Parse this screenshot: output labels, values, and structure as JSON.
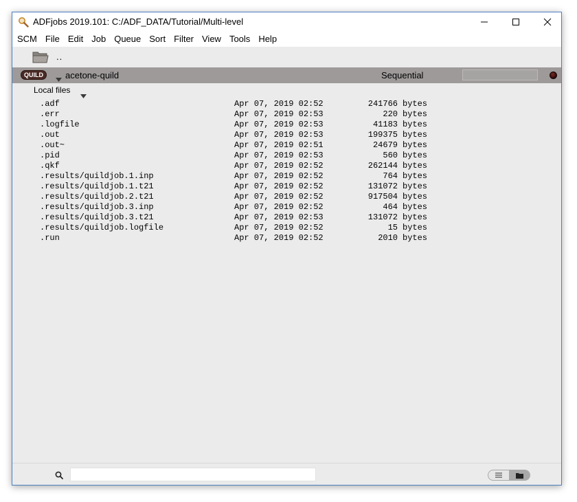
{
  "window": {
    "title": "ADFjobs 2019.101: C:/ADF_DATA/Tutorial/Multi-level"
  },
  "menu": [
    "SCM",
    "File",
    "Edit",
    "Job",
    "Queue",
    "Sort",
    "Filter",
    "View",
    "Tools",
    "Help"
  ],
  "toolbar": {
    "parent_dir": ".."
  },
  "job": {
    "badge": "QUILD",
    "name": "acetone-quild",
    "mode": "Sequential",
    "field_value": ""
  },
  "files_section": {
    "label": "Local files"
  },
  "files": [
    {
      "name": ".adf",
      "date": "Apr 07, 2019 02:52",
      "size": "241766",
      "unit": "bytes"
    },
    {
      "name": ".err",
      "date": "Apr 07, 2019 02:53",
      "size": "220",
      "unit": "bytes"
    },
    {
      "name": ".logfile",
      "date": "Apr 07, 2019 02:53",
      "size": "41183",
      "unit": "bytes"
    },
    {
      "name": ".out",
      "date": "Apr 07, 2019 02:53",
      "size": "199375",
      "unit": "bytes"
    },
    {
      "name": ".out~",
      "date": "Apr 07, 2019 02:51",
      "size": "24679",
      "unit": "bytes"
    },
    {
      "name": ".pid",
      "date": "Apr 07, 2019 02:53",
      "size": "560",
      "unit": "bytes"
    },
    {
      "name": ".qkf",
      "date": "Apr 07, 2019 02:52",
      "size": "262144",
      "unit": "bytes"
    },
    {
      "name": ".results/quildjob.1.inp",
      "date": "Apr 07, 2019 02:52",
      "size": "764",
      "unit": "bytes"
    },
    {
      "name": ".results/quildjob.1.t21",
      "date": "Apr 07, 2019 02:52",
      "size": "131072",
      "unit": "bytes"
    },
    {
      "name": ".results/quildjob.2.t21",
      "date": "Apr 07, 2019 02:52",
      "size": "917504",
      "unit": "bytes"
    },
    {
      "name": ".results/quildjob.3.inp",
      "date": "Apr 07, 2019 02:52",
      "size": "464",
      "unit": "bytes"
    },
    {
      "name": ".results/quildjob.3.t21",
      "date": "Apr 07, 2019 02:53",
      "size": "131072",
      "unit": "bytes"
    },
    {
      "name": ".results/quildjob.logfile",
      "date": "Apr 07, 2019 02:52",
      "size": "15",
      "unit": "bytes"
    },
    {
      "name": ".run",
      "date": "Apr 07, 2019 02:52",
      "size": "2010",
      "unit": "bytes"
    }
  ],
  "search": {
    "value": "",
    "placeholder": ""
  },
  "icons": {
    "app": "magnifier-app-icon",
    "folder": "folder-icon",
    "search": "search-icon",
    "list_view": "list-view-icon",
    "folder_view": "folder-view-icon"
  },
  "colors": {
    "job_row": "#9e9a9a",
    "badge": "#4a2a24",
    "status_light": "#3a0c0a",
    "window_bg": "#ebebeb"
  }
}
